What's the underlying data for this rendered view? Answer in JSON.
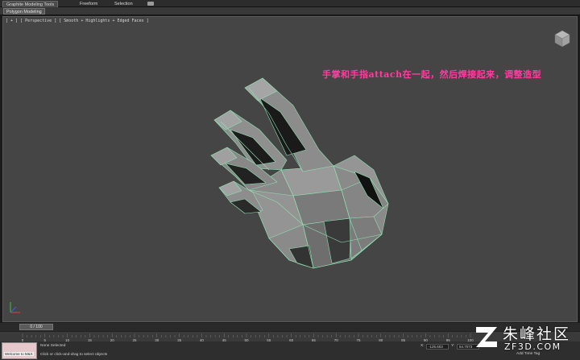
{
  "ribbon": {
    "tabs": [
      {
        "label": "Graphite Modeling Tools",
        "active": true
      },
      {
        "label": "Freeform",
        "active": false
      },
      {
        "label": "Selection",
        "active": false
      }
    ],
    "panel_label": "Polygon Modeling"
  },
  "viewport": {
    "label": "[ + ] [ Perspective ] [ Smooth + Highlights + Edged Faces ]",
    "annotation": "手掌和手指attach在一起，然后焊接起来，调整造型"
  },
  "timeline": {
    "slider_label": "0 / 100",
    "ticks": [
      "0",
      "5",
      "10",
      "15",
      "20",
      "25",
      "30",
      "35",
      "40",
      "45",
      "50",
      "55",
      "60",
      "65",
      "70",
      "75",
      "80",
      "85",
      "90",
      "95",
      "100"
    ]
  },
  "status_bar": {
    "listener_label": "Welcome to M&X",
    "selection_status": "None Selected",
    "prompt": "Click or click-and-drag to select objects",
    "x_value": "-125.603",
    "y_value": "54.7073",
    "add_time_tag": "Add Time Tag"
  },
  "watermark": {
    "title": "朱峰社区",
    "subtitle": "ZF3D.COM"
  }
}
